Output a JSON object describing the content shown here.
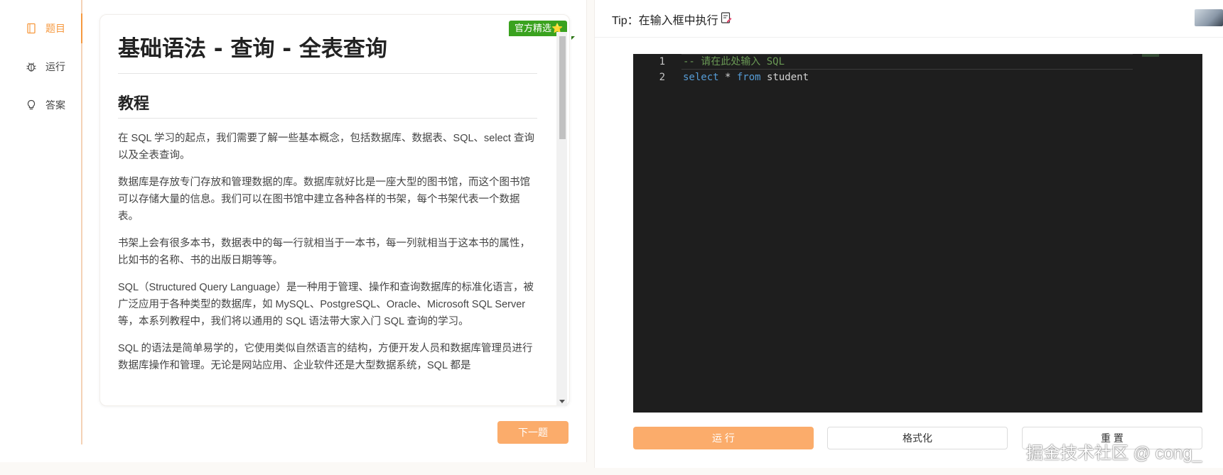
{
  "nav": {
    "items": [
      {
        "label": "题目",
        "icon": "document-icon"
      },
      {
        "label": "运行",
        "icon": "bug-icon"
      },
      {
        "label": "答案",
        "icon": "lightbulb-icon"
      }
    ],
    "active_color": "#f6993f"
  },
  "article": {
    "badge": "官方精选⭐",
    "title": "基础语法 - 查询 - 全表查询",
    "section_title": "教程",
    "paragraphs": [
      "在 SQL 学习的起点，我们需要了解一些基本概念，包括数据库、数据表、SQL、select 查询以及全表查询。",
      "数据库是存放专门存放和管理数据的库。数据库就好比是一座大型的图书馆，而这个图书馆可以存储大量的信息。我们可以在图书馆中建立各种各样的书架，每个书架代表一个数据表。",
      "书架上会有很多本书，数据表中的每一行就相当于一本书，每一列就相当于这本书的属性，比如书的名称、书的出版日期等等。",
      "SQL（Structured Query Language）是一种用于管理、操作和查询数据库的标准化语言，被广泛应用于各种类型的数据库，如 MySQL、PostgreSQL、Oracle、Microsoft SQL Server 等，本系列教程中，我们将以通用的 SQL 语法带大家入门 SQL 查询的学习。",
      "SQL 的语法是简单易学的，它使用类似自然语言的结构，方便开发人员和数据库管理员进行数据库操作和管理。无论是网站应用、企业软件还是大型数据系统，SQL 都是"
    ]
  },
  "next_button": "下一题",
  "tip": {
    "label": "Tip：在输入框中执行",
    "icon": "edit-icon"
  },
  "editor": {
    "lines": [
      {
        "num": "1",
        "tokens": [
          {
            "t": "-- 请在此处输入 SQL",
            "c": "comment"
          }
        ]
      },
      {
        "num": "2",
        "tokens": [
          {
            "t": "select",
            "c": "kw"
          },
          {
            "t": " * ",
            "c": "op"
          },
          {
            "t": "from",
            "c": "kw"
          },
          {
            "t": " student",
            "c": "id"
          }
        ]
      }
    ]
  },
  "buttons": {
    "run": "运 行",
    "format": "格式化",
    "reset": "重 置"
  },
  "watermark": "掘金技术社区 @ cong_",
  "colors": {
    "accent": "#fbac6b",
    "badge_green": "#3aa21f",
    "editor_bg": "#1e1e1e"
  }
}
